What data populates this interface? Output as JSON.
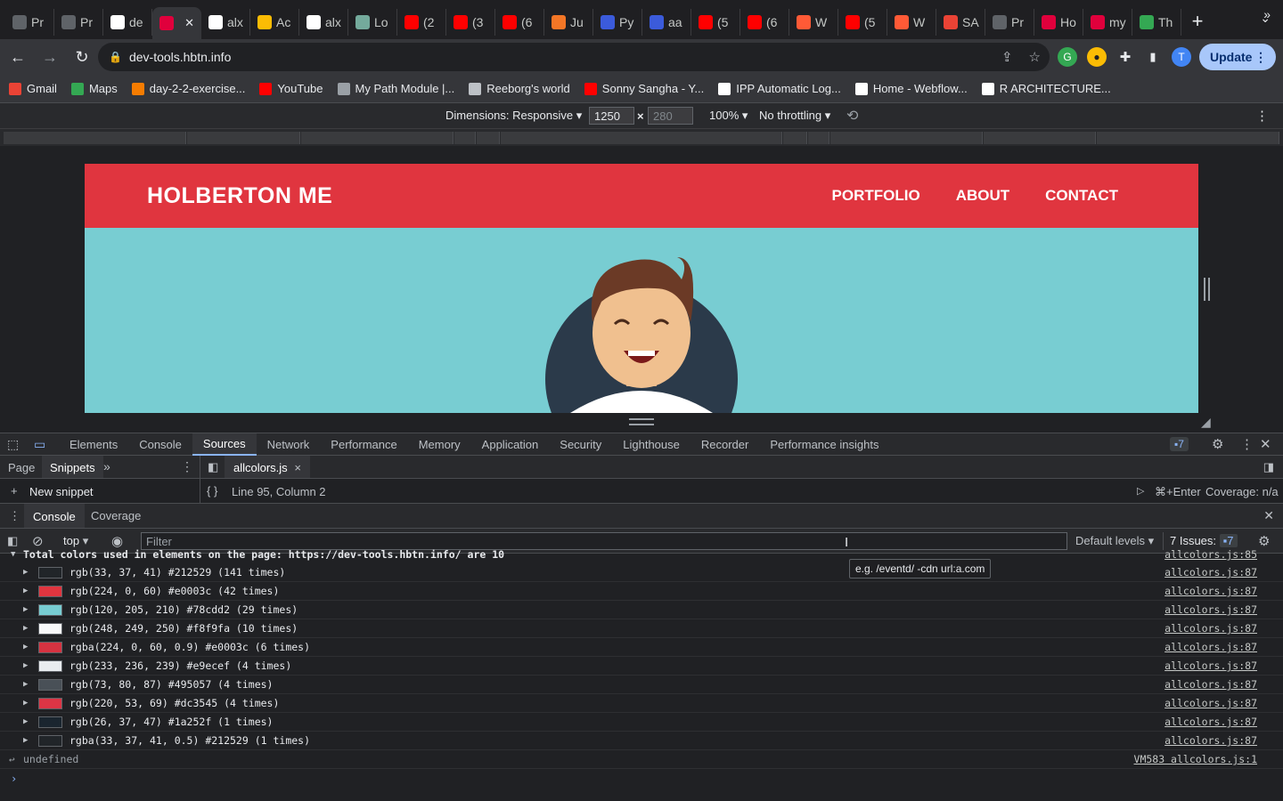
{
  "browser": {
    "tabs": [
      {
        "label": "Pr",
        "icon": "generic-tab-icon",
        "color": "#5f6368"
      },
      {
        "label": "Pr",
        "icon": "generic-tab-icon",
        "color": "#5f6368"
      },
      {
        "label": "de",
        "icon": "github-icon",
        "color": "#ffffff"
      },
      {
        "label": "",
        "icon": "active-site-icon",
        "color": "#e0003c",
        "active": true
      },
      {
        "label": "alx",
        "icon": "github-icon",
        "color": "#ffffff"
      },
      {
        "label": "Ac",
        "icon": "chrome-icon",
        "color": "#fbbc04"
      },
      {
        "label": "alx",
        "icon": "github-icon",
        "color": "#ffffff"
      },
      {
        "label": "Lo",
        "icon": "openai-icon",
        "color": "#74aa9c"
      },
      {
        "label": "(2",
        "icon": "youtube-icon",
        "color": "#ff0000"
      },
      {
        "label": "(3",
        "icon": "youtube-icon",
        "color": "#ff0000"
      },
      {
        "label": "(6",
        "icon": "youtube-icon",
        "color": "#ff0000"
      },
      {
        "label": "Ju",
        "icon": "jupyter-icon",
        "color": "#f37626"
      },
      {
        "label": "Py",
        "icon": "python-icon",
        "color": "#3b5bdb"
      },
      {
        "label": "aa",
        "icon": "doc-icon",
        "color": "#3b5bdb"
      },
      {
        "label": "(5",
        "icon": "youtube-icon",
        "color": "#ff0000"
      },
      {
        "label": "(6",
        "icon": "youtube-icon",
        "color": "#ff0000"
      },
      {
        "label": "W",
        "icon": "webflow-icon",
        "color": "#ff5a36"
      },
      {
        "label": "(5",
        "icon": "youtube-icon",
        "color": "#ff0000"
      },
      {
        "label": "W",
        "icon": "webflow-icon",
        "color": "#ff5a36"
      },
      {
        "label": "SA",
        "icon": "gmail-icon",
        "color": "#ea4335"
      },
      {
        "label": "Pr",
        "icon": "generic-tab-icon",
        "color": "#5f6368"
      },
      {
        "label": "Ho",
        "icon": "holberton-icon",
        "color": "#e0003c"
      },
      {
        "label": "my",
        "icon": "holberton-icon",
        "color": "#e0003c"
      },
      {
        "label": "Th",
        "icon": "leaf-icon",
        "color": "#34a853"
      }
    ],
    "url": "dev-tools.hbtn.info",
    "update_label": "Update",
    "profile_initial": "T",
    "bookmarks": [
      {
        "label": "Gmail",
        "icon": "gmail-icon",
        "color": "#ea4335"
      },
      {
        "label": "Maps",
        "icon": "maps-icon",
        "color": "#34a853"
      },
      {
        "label": "day-2-2-exercise...",
        "icon": "bookmark-icon",
        "color": "#f57c00"
      },
      {
        "label": "YouTube",
        "icon": "youtube-icon",
        "color": "#ff0000"
      },
      {
        "label": "My Path Module |...",
        "icon": "globe-icon",
        "color": "#9aa0a6"
      },
      {
        "label": "Reeborg's world",
        "icon": "robot-icon",
        "color": "#bdc1c6"
      },
      {
        "label": "Sonny Sangha - Y...",
        "icon": "youtube-icon",
        "color": "#ff0000"
      },
      {
        "label": "IPP Automatic Log...",
        "icon": "ipp-icon",
        "color": "#ffffff"
      },
      {
        "label": "Home - Webflow...",
        "icon": "webflow-icon",
        "color": "#ffffff"
      },
      {
        "label": "R ARCHITECTURE...",
        "icon": "building-icon",
        "color": "#ffffff"
      }
    ]
  },
  "device_toolbar": {
    "dimensions_label": "Dimensions: Responsive",
    "width": "1250",
    "height_placeholder": "280",
    "times": "×",
    "zoom": "100%",
    "throttling": "No throttling"
  },
  "site": {
    "brand": "HOLBERTON ME",
    "nav": [
      "PORTFOLIO",
      "ABOUT",
      "CONTACT"
    ],
    "colors": {
      "header": "#e0353f",
      "hero": "#78cdd2",
      "circle": "#2b3a4a"
    }
  },
  "devtools": {
    "tabs": [
      "Elements",
      "Console",
      "Sources",
      "Network",
      "Performance",
      "Memory",
      "Application",
      "Security",
      "Lighthouse",
      "Recorder",
      "Performance insights"
    ],
    "active_tab": "Sources",
    "issues_count": "7",
    "sources": {
      "nav_tabs": [
        "Page",
        "Snippets"
      ],
      "active_nav": "Snippets",
      "new_snippet": "New snippet",
      "open_file": "allcolors.js",
      "cursor_status": "Line 95, Column 2",
      "run_shortcut": "⌘+Enter",
      "coverage": "Coverage: n/a"
    },
    "drawer": {
      "tabs": [
        "Console",
        "Coverage"
      ],
      "active": "Console",
      "context": "top",
      "filter_placeholder": "Filter",
      "levels": "Default levels",
      "issues_label": "7 Issues:",
      "issues_badge": "7",
      "tooltip": "e.g. /eventd/ -cdn url:a.com"
    },
    "console": {
      "header_line": "Total colors used in elements on the page: https://dev-tools.hbtn.info/ are 10",
      "header_src": "allcolors.js:85",
      "rows": [
        {
          "text": "rgb(33, 37, 41) #212529 (141 times)",
          "swatch": "#212529",
          "src": "allcolors.js:87"
        },
        {
          "text": "rgb(224, 0, 60) #e0003c (42 times)",
          "swatch": "#e0353f",
          "src": "allcolors.js:87"
        },
        {
          "text": "rgb(120, 205, 210) #78cdd2 (29 times)",
          "swatch": "#78cdd2",
          "src": "allcolors.js:87"
        },
        {
          "text": "rgb(248, 249, 250) #f8f9fa (10 times)",
          "swatch": "#f8f9fa",
          "src": "allcolors.js:87"
        },
        {
          "text": "rgba(224, 0, 60, 0.9) #e0003c (6 times)",
          "swatch": "#d63341",
          "src": "allcolors.js:87"
        },
        {
          "text": "rgb(233, 236, 239) #e9ecef (4 times)",
          "swatch": "#e9ecef",
          "src": "allcolors.js:87"
        },
        {
          "text": "rgb(73, 80, 87) #495057 (4 times)",
          "swatch": "#495057",
          "src": "allcolors.js:87"
        },
        {
          "text": "rgb(220, 53, 69) #dc3545 (4 times)",
          "swatch": "#dc3545",
          "src": "allcolors.js:87"
        },
        {
          "text": "rgb(26, 37, 47) #1a252f (1 times)",
          "swatch": "#1a252f",
          "src": "allcolors.js:87"
        },
        {
          "text": "rgba(33, 37, 41, 0.5) #212529 (1 times)",
          "swatch": "#212529",
          "src": "allcolors.js:87"
        }
      ],
      "result": "undefined",
      "result_src": "VM583 allcolors.js:1"
    }
  }
}
